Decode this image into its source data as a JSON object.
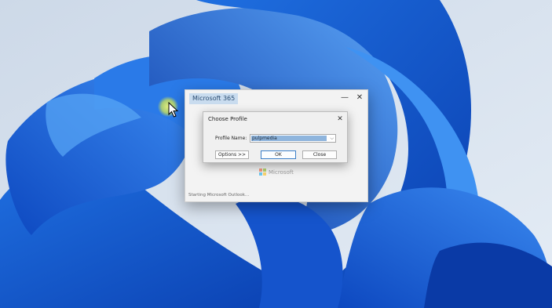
{
  "splash": {
    "title": "Microsoft 365",
    "minimize_glyph": "—",
    "close_glyph": "✕",
    "logo_text": "Microsoft",
    "status": "Starting Microsoft Outlook..."
  },
  "dialog": {
    "title": "Choose Profile",
    "close_glyph": "✕",
    "profile_label": "Profile Name:",
    "profile_value": "pulpmedia",
    "dropdown_glyph": "⌵",
    "options_label": "Options >>",
    "ok_label": "OK",
    "close_label": "Close"
  },
  "icons": {
    "cursor": "arrow-pointer-icon",
    "logo": "microsoft-logo-icon"
  },
  "colors": {
    "ms_red": "#f25022",
    "ms_green": "#7fba00",
    "ms_blue": "#00a4ef",
    "ms_yellow": "#ffb900",
    "accent": "#3c7fc8"
  }
}
